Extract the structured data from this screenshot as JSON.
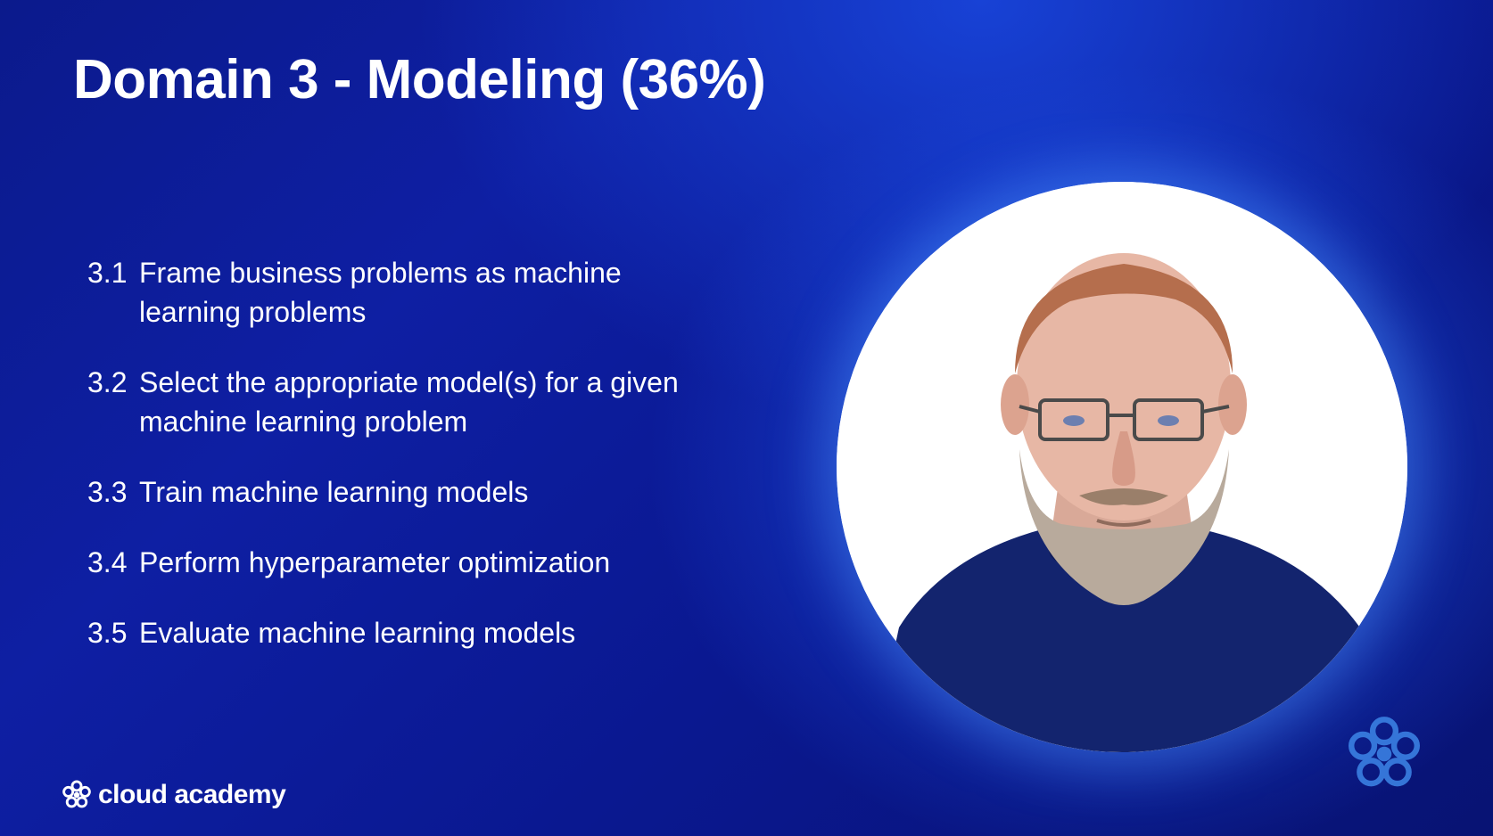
{
  "slide": {
    "title": "Domain 3 - Modeling (36%)",
    "outline": [
      {
        "number": "3.1",
        "text": "Frame business problems as machine learning problems"
      },
      {
        "number": "3.2",
        "text": "Select the appropriate model(s) for a given machine learning problem"
      },
      {
        "number": "3.3",
        "text": "Train machine learning models"
      },
      {
        "number": "3.4",
        "text": "Perform hyperparameter optimization"
      },
      {
        "number": "3.5",
        "text": "Evaluate machine learning models"
      }
    ]
  },
  "brand": {
    "wordmark": "cloud academy",
    "logo_icon": "cloud-academy-flower-icon",
    "watermark_icon": "cloud-academy-flower-icon"
  },
  "speaker": {
    "icon": "presenter-video"
  },
  "colors": {
    "background": "#0e1fa3",
    "text": "#ffffff",
    "video_background": "#ffffff",
    "shirt": "#13246e"
  }
}
